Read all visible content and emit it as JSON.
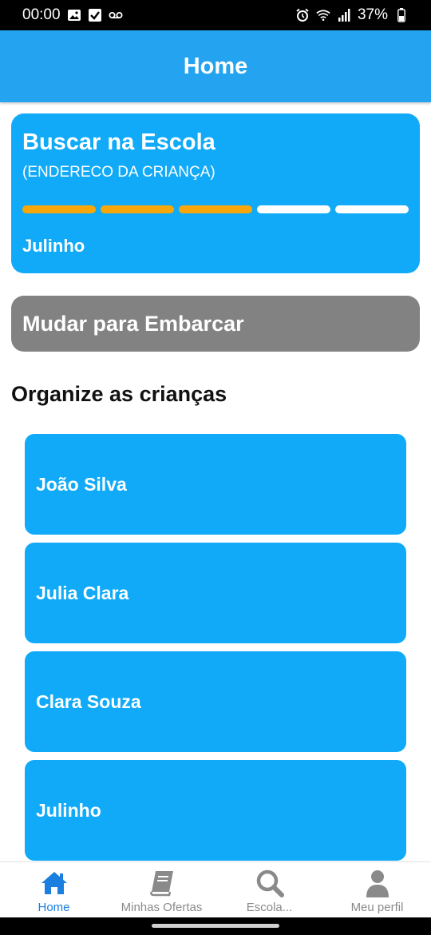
{
  "status_bar": {
    "time": "00:00",
    "battery": "37%",
    "icons": [
      "image-icon",
      "checkbox-icon",
      "voicemail-icon",
      "alarm-icon",
      "wifi-icon",
      "signal-icon",
      "battery-icon"
    ]
  },
  "appbar": {
    "title": "Home"
  },
  "trip_card": {
    "title": "Buscar na Escola",
    "subtitle": "(ENDERECO DA CRIANÇA)",
    "progress": {
      "total_steps": 5,
      "completed_steps": 3
    },
    "child_name": "Julinho",
    "colors": {
      "card": "#10aaf8",
      "progress_done": "#f7a70a",
      "progress_pending": "#ffffff"
    }
  },
  "switch_button": {
    "label": "Mudar para Embarcar"
  },
  "section": {
    "title": "Organize as crianças"
  },
  "children": [
    {
      "name": "João Silva"
    },
    {
      "name": "Julia Clara"
    },
    {
      "name": "Clara Souza"
    },
    {
      "name": "Julinho"
    }
  ],
  "tab_bar": {
    "tabs": [
      {
        "label": "Home",
        "icon": "home-icon",
        "active": true
      },
      {
        "label": "Minhas Ofertas",
        "icon": "book-icon",
        "active": false
      },
      {
        "label": "Escola...",
        "icon": "search-icon",
        "active": false
      },
      {
        "label": "Meu perfil",
        "icon": "person-icon",
        "active": false
      }
    ]
  },
  "colors": {
    "accent": "#23a3f0",
    "active_tab": "#1b7fe0",
    "inactive_tab": "#8a8a8a",
    "switch_button": "#828282"
  }
}
